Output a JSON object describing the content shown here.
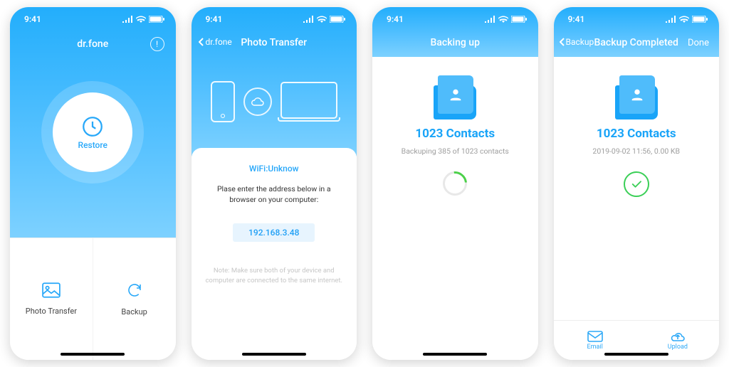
{
  "status": {
    "time": "9:41"
  },
  "s1": {
    "app_name": "dr.fone",
    "restore_label": "Restore",
    "photo_transfer_label": "Photo Transfer",
    "backup_label": "Backup"
  },
  "s2": {
    "back_label": "dr.fone",
    "title": "Photo Transfer",
    "wifi_label": "WiFi:Unknow",
    "instruction": "Plase enter the address below in a browser on your computer:",
    "ip": "192.168.3.48",
    "note": "Note: Make sure both of your device and computer are connected to the same internet."
  },
  "s3": {
    "title": "Backing up",
    "contacts_header": "1023 Contacts",
    "progress_text": "Backuping 385 of 1023 contacts"
  },
  "s4": {
    "back_label": "Backup",
    "title": "Backup Completed",
    "done_label": "Done",
    "contacts_header": "1023 Contacts",
    "meta": "2019-09-02 11:56, 0.00 KB",
    "email_label": "Email",
    "upload_label": "Upload"
  }
}
